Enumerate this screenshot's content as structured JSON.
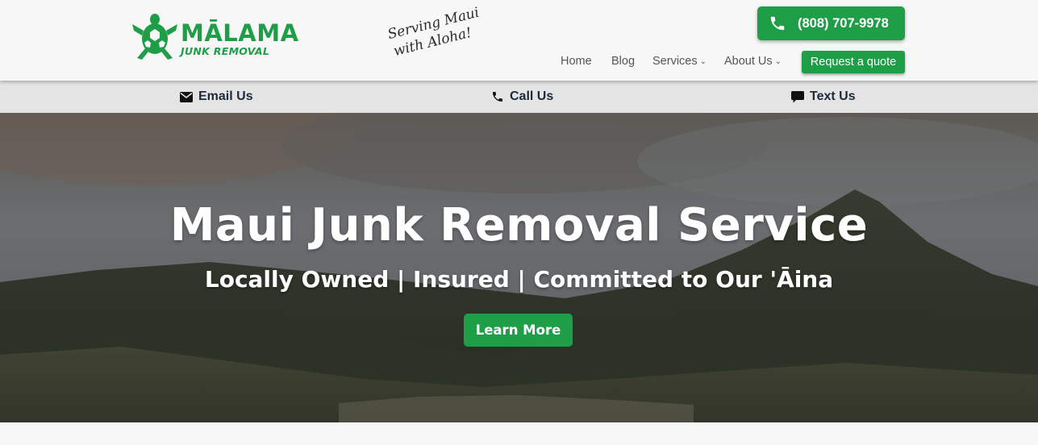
{
  "brand": {
    "name": "MĀLAMA",
    "subtitle": "JUNK REMOVAL",
    "tagline_line1": "Serving Maui",
    "tagline_line2": "with Aloha!",
    "accent_color": "#1e9e47"
  },
  "header": {
    "phone_label": "(808) 707-9978",
    "phone_icon": "phone-icon",
    "nav": [
      {
        "label": "Home"
      },
      {
        "label": "Blog"
      },
      {
        "label": "Services",
        "has_dropdown": true
      },
      {
        "label": "About Us",
        "has_dropdown": true
      }
    ],
    "quote_label": "Request a quote"
  },
  "contact_bar": {
    "email_label": "Email Us",
    "call_label": "Call Us",
    "text_label": "Text Us"
  },
  "hero": {
    "title": "Maui Junk Removal Service",
    "subtitle": "Locally Owned | Insured | Committed to Our 'Āina",
    "button_label": "Learn More"
  }
}
